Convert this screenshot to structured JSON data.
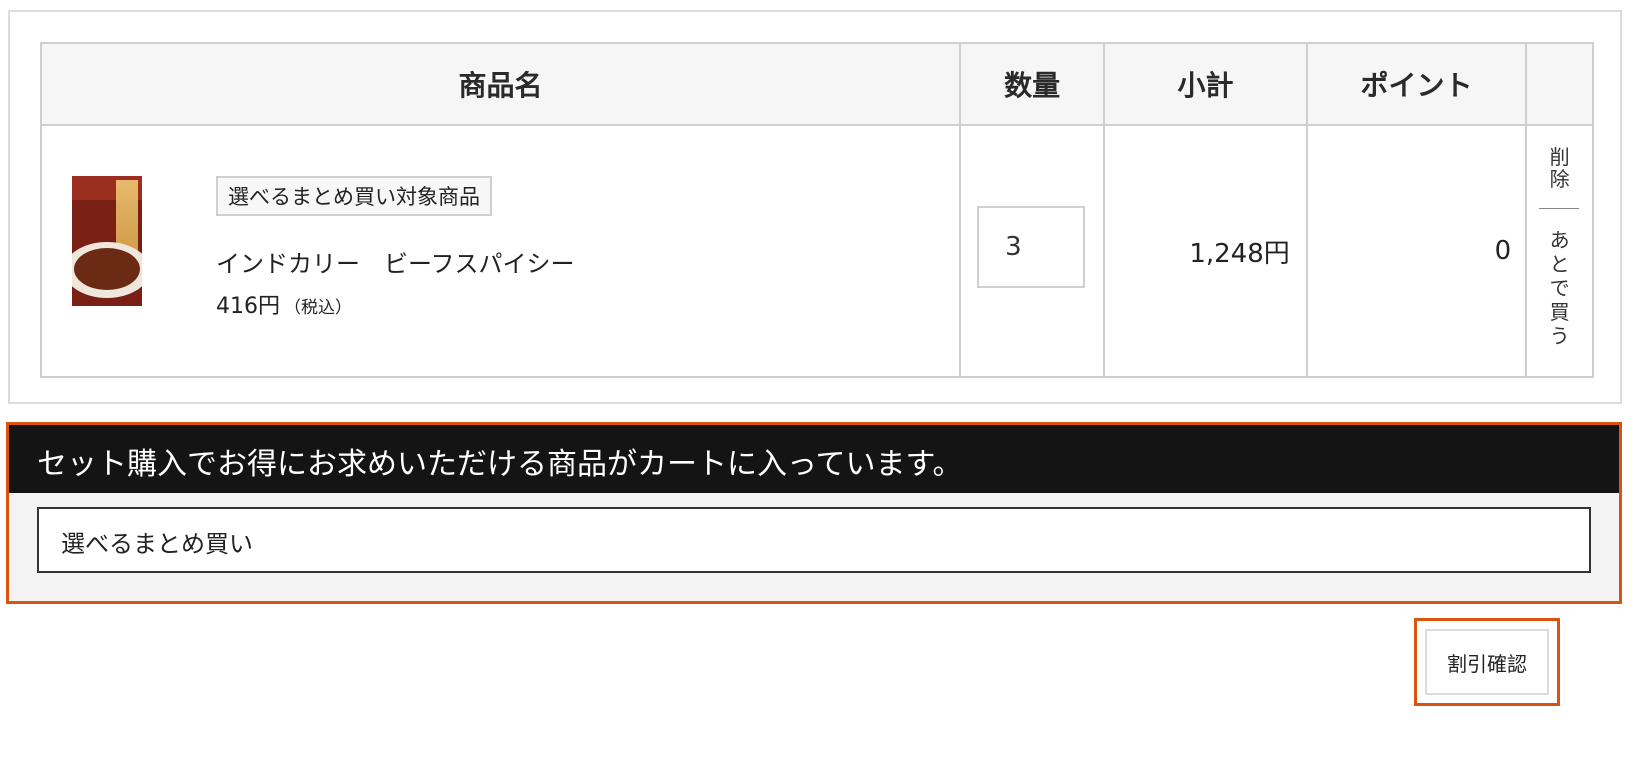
{
  "table": {
    "headers": {
      "product": "商品名",
      "quantity": "数量",
      "subtotal": "小計",
      "points": "ポイント"
    },
    "row": {
      "badge": "選べるまとめ買い対象商品",
      "name": "インドカリー　ビーフスパイシー",
      "unit_price": "416円",
      "tax_note": "（税込）",
      "quantity": "3",
      "subtotal": "1,248円",
      "points": "0",
      "delete_label": [
        "削",
        "除"
      ],
      "later_label": [
        "あ",
        "と",
        "で",
        "買",
        "う"
      ]
    }
  },
  "set_offer": {
    "header": "セット購入でお得にお求めいただける商品がカートに入っています。",
    "item": "選べるまとめ買い"
  },
  "discount_button": "割引確認",
  "colors": {
    "accent_border": "#d9540d",
    "set_header_bg": "#141414",
    "table_header_bg": "#f6f6f6"
  },
  "icons": {
    "product_image": "curry-package-image"
  }
}
